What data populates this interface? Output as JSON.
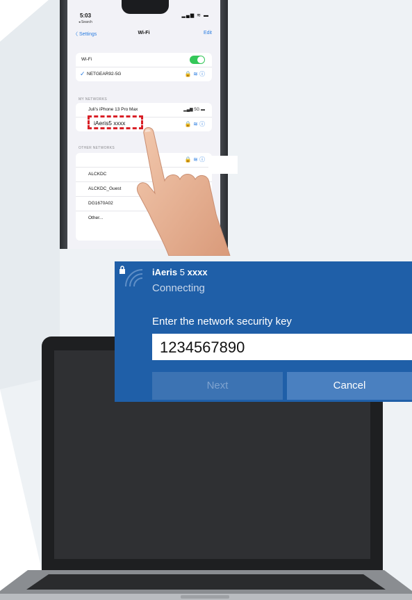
{
  "phone": {
    "status_time": "5:03",
    "status_back": "◂ Search",
    "status_icons": "▂▄▆ ≋ ▬",
    "nav_back": "〈 Settings",
    "nav_title": "Wi-Fi",
    "nav_edit": "Edit",
    "wifi_label": "Wi-Fi",
    "connected_network": "NETGEAR92-5G",
    "my_networks_header": "MY NETWORKS",
    "hotspot_name": "Juli's iPhone 13 Pro Max",
    "hotspot_signal": "▂▄▆ 5G ▬",
    "highlighted_network": "iAeris5 xxxx",
    "other_networks_header": "OTHER NETWORKS",
    "other_networks": [
      "ALCKDC",
      "ALCKDC_Guest",
      "DG1670A02",
      "Other..."
    ],
    "row_icons": "🔒 ≋ ⓘ"
  },
  "dialog": {
    "ssid_prefix": "iAeris",
    "ssid_num": "5",
    "ssid_suffix": "xxxx",
    "status": "Connecting",
    "prompt": "Enter the network security key",
    "key_value": "1234567890",
    "next_label": "Next",
    "cancel_label": "Cancel"
  },
  "colors": {
    "dialog_bg": "#1f5fa8",
    "ios_blue": "#2a7de1",
    "toggle_green": "#34c759",
    "highlight_red": "#d92027"
  }
}
